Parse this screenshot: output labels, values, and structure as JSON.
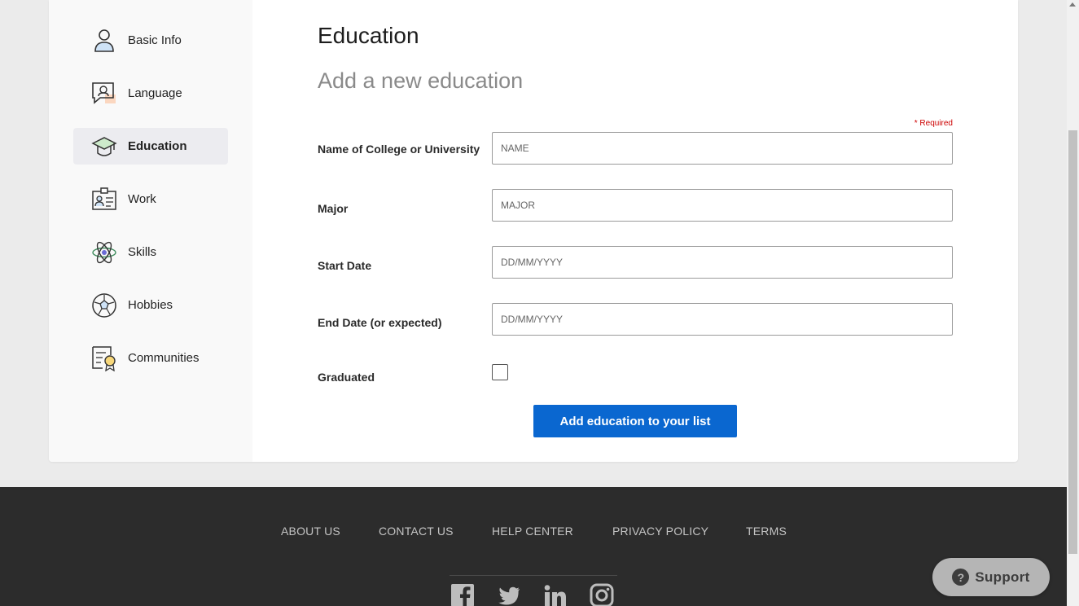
{
  "sidebar": {
    "items": [
      {
        "label": "Basic Info",
        "icon": "person-icon"
      },
      {
        "label": "Language",
        "icon": "speech-bubble-icon"
      },
      {
        "label": "Education",
        "icon": "graduation-cap-icon",
        "active": true
      },
      {
        "label": "Work",
        "icon": "id-card-icon"
      },
      {
        "label": "Skills",
        "icon": "atom-icon"
      },
      {
        "label": "Hobbies",
        "icon": "soccer-ball-icon"
      },
      {
        "label": "Communities",
        "icon": "certificate-icon"
      }
    ]
  },
  "main": {
    "title": "Education",
    "subtitle": "Add a new education",
    "required_note": "* Required",
    "fields": {
      "college": {
        "label": "Name of College or University",
        "placeholder": "NAME",
        "value": ""
      },
      "major": {
        "label": "Major",
        "placeholder": "MAJOR",
        "value": ""
      },
      "start_date": {
        "label": "Start Date",
        "placeholder": "DD/MM/YYYY",
        "value": ""
      },
      "end_date": {
        "label": "End Date (or expected)",
        "placeholder": "DD/MM/YYYY",
        "value": ""
      },
      "graduated": {
        "label": "Graduated",
        "checked": false
      }
    },
    "add_button": "Add education to your list"
  },
  "footer": {
    "links": [
      "ABOUT US",
      "CONTACT US",
      "HELP CENTER",
      "PRIVACY POLICY",
      "TERMS"
    ],
    "social": [
      "facebook-icon",
      "twitter-icon",
      "linkedin-icon",
      "instagram-icon"
    ]
  },
  "support": {
    "label": "Support",
    "icon": "question-icon"
  },
  "colors": {
    "accent": "#0a67d0",
    "footer_bg": "#2c2c2c",
    "required": "#cc0000",
    "active_nav_bg": "#ececf0"
  }
}
